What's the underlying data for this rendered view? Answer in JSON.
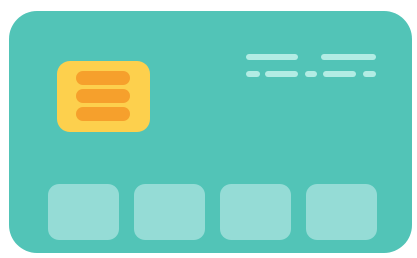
{
  "card": {
    "icon": "credit-card-icon",
    "colors": {
      "body": "#52c4b7",
      "chip": "#fdd04d",
      "chip_lines": "#f6a02c",
      "dashes": "#b2ece4",
      "blocks": "#95dcd6"
    },
    "chip": {
      "icon": "card-chip-icon",
      "line_count": 3
    },
    "dash_rows": [
      {
        "segments": 2
      },
      {
        "segments": 5
      }
    ],
    "number_blocks": 4
  }
}
